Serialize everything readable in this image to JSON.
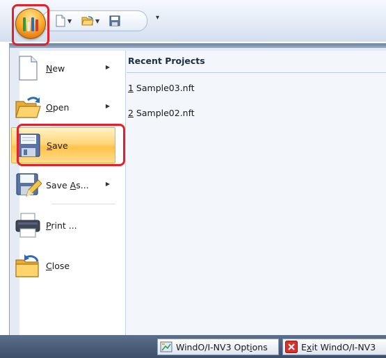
{
  "quick_access": {
    "new_icon": "new-document-icon",
    "open_icon": "open-folder-icon",
    "save_icon": "save-disk-icon",
    "customize_icon": "customize-arrow-icon"
  },
  "app_button": {
    "icon": "app-orb-icon"
  },
  "menu": {
    "items": [
      {
        "pre": "",
        "key": "N",
        "post": "ew",
        "has_submenu": true,
        "icon": "new-document-icon"
      },
      {
        "pre": "",
        "key": "O",
        "post": "pen",
        "has_submenu": true,
        "icon": "open-folder-icon"
      },
      {
        "pre": "",
        "key": "S",
        "post": "ave",
        "has_submenu": false,
        "icon": "save-disk-icon",
        "selected": true
      },
      {
        "pre": "Save ",
        "key": "A",
        "post": "s...",
        "has_submenu": true,
        "icon": "save-as-icon"
      },
      {
        "pre": "",
        "key": "P",
        "post": "rint ...",
        "has_submenu": false,
        "icon": "printer-icon"
      },
      {
        "pre": "",
        "key": "C",
        "post": "lose",
        "has_submenu": false,
        "icon": "close-folder-icon"
      }
    ]
  },
  "recent": {
    "title": "Recent Projects",
    "items": [
      {
        "num": "1",
        "name": " Sample03.nft"
      },
      {
        "num": "2",
        "name": " Sample02.nft"
      }
    ]
  },
  "footer": {
    "options": {
      "pre": "WindO/I-NV3 Opt",
      "key": "i",
      "post": "ons",
      "icon": "options-icon"
    },
    "exit": {
      "pre": "E",
      "key": "x",
      "post": "it WindO/I-NV3",
      "icon": "exit-x-icon"
    }
  },
  "colors": {
    "highlight": "#e4202a",
    "selected_bg": "#ffd67a",
    "orb": "#ffb433"
  }
}
